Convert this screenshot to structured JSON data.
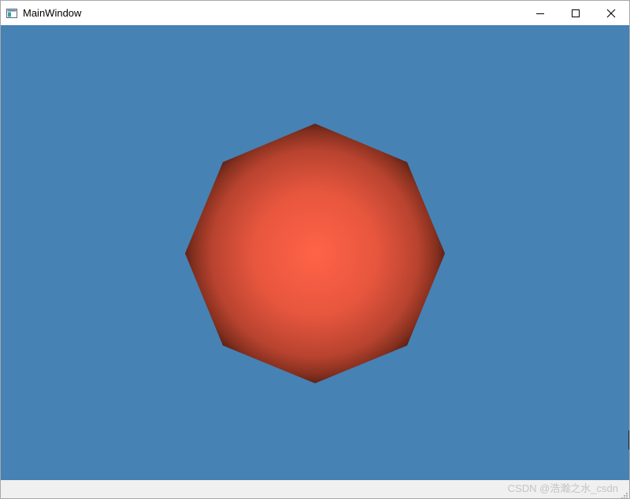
{
  "window": {
    "title": "MainWindow",
    "icons": {
      "app": "app-window-icon",
      "minimize": "minimize-icon",
      "maximize": "maximize-icon",
      "close": "close-icon"
    }
  },
  "viewport": {
    "background_color": "#4682b4",
    "shape": {
      "kind": "octagon",
      "center_color": "#ff6347",
      "edge_color": "#3a1510"
    }
  },
  "statusbar": {
    "watermark": "CSDN @浩瀚之水_csdn"
  }
}
